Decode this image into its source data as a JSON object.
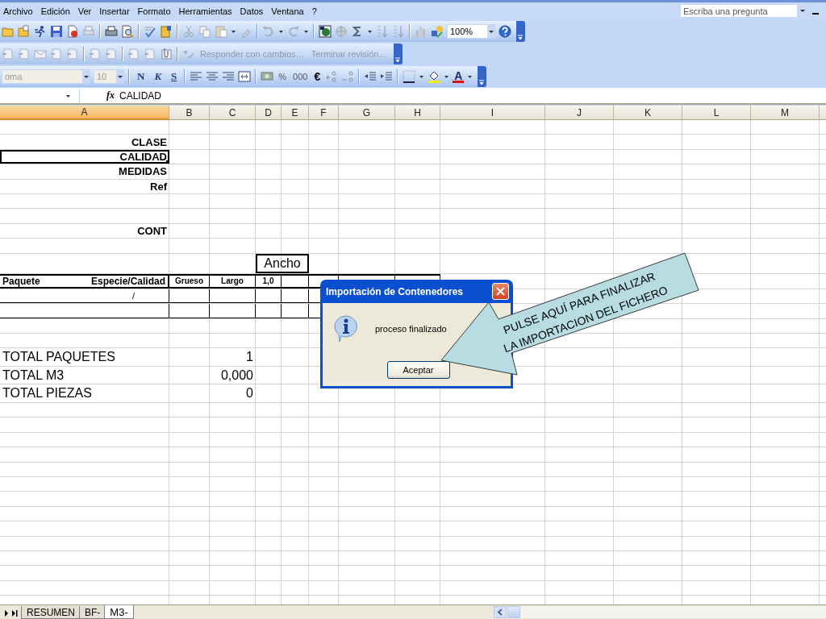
{
  "menu": {
    "items": [
      "Archivo",
      "Edición",
      "Ver",
      "Insertar",
      "Formato",
      "Herramientas",
      "Datos",
      "Ventana",
      "?"
    ],
    "help_box": {
      "placeholder": "Escriba una pregunta"
    }
  },
  "standard_toolbar": {
    "zoom": "100%"
  },
  "review_toolbar": {
    "buttons": [
      "Responder con cambios…",
      "Terminar revisión…"
    ]
  },
  "format_toolbar": {
    "font": "oma",
    "size": "10",
    "style_buttons": [
      "N",
      "K",
      "S"
    ],
    "number_buttons": [
      "%",
      "000",
      "€"
    ],
    "font_color_label": "A"
  },
  "formula_bar": {
    "function_label": "fx",
    "formula": "CALIDAD"
  },
  "sheet": {
    "columns": [
      {
        "label": "A",
        "selected": true
      },
      {
        "label": "B",
        "selected": false
      },
      {
        "label": "C",
        "selected": false
      },
      {
        "label": "D",
        "selected": false
      },
      {
        "label": "E",
        "selected": false
      },
      {
        "label": "F",
        "selected": false
      },
      {
        "label": "G",
        "selected": false
      },
      {
        "label": "H",
        "selected": false
      },
      {
        "label": "I",
        "selected": false
      },
      {
        "label": "J",
        "selected": false
      },
      {
        "label": "K",
        "selected": false
      },
      {
        "label": "L",
        "selected": false
      },
      {
        "label": "M",
        "selected": false
      }
    ],
    "rows": [
      {
        "kind": "blank",
        "selected": false
      },
      {
        "kind": "label",
        "selected": false,
        "cells": {
          "A": "CLASE"
        }
      },
      {
        "kind": "label",
        "selected": true,
        "cells": {
          "A": "CALIDAD"
        }
      },
      {
        "kind": "label",
        "selected": false,
        "cells": {
          "A": "MEDIDAS"
        }
      },
      {
        "kind": "label",
        "selected": false,
        "cells": {
          "A": "Ref"
        }
      },
      {
        "kind": "blank",
        "selected": false
      },
      {
        "kind": "blank",
        "selected": false
      },
      {
        "kind": "label",
        "selected": false,
        "cells": {
          "A": "CONT"
        }
      },
      {
        "kind": "blank",
        "selected": false
      },
      {
        "kind": "ancho",
        "selected": false,
        "cells": {
          "D": "Ancho"
        }
      },
      {
        "kind": "table_header",
        "selected": false,
        "cells": {
          "A": [
            "Paquete",
            "Especie/Calidad"
          ],
          "B": "Grueso",
          "C": "Largo",
          "D": "1,0"
        }
      },
      {
        "kind": "table_row",
        "selected": false,
        "cells": {
          "A": "/"
        }
      },
      {
        "kind": "table_row",
        "selected": false
      },
      {
        "kind": "blank",
        "selected": false
      },
      {
        "kind": "blank",
        "selected": false
      },
      {
        "kind": "total",
        "selected": false,
        "cells": {
          "A": "TOTAL PAQUETES",
          "C": "1"
        }
      },
      {
        "kind": "total",
        "selected": false,
        "cells": {
          "A": "TOTAL M3",
          "C": "0,000"
        }
      },
      {
        "kind": "total",
        "selected": false,
        "cells": {
          "A": "TOTAL PIEZAS",
          "C": "0"
        }
      }
    ]
  },
  "sheet_tabs": [
    {
      "label": "RESUMEN",
      "selected": false
    },
    {
      "label": "BF-",
      "selected": false
    },
    {
      "label": "M3-",
      "selected": true
    }
  ],
  "dialog": {
    "title": "Importación de Contenedores",
    "message": "proceso finalizado",
    "button": "Aceptar"
  },
  "callout": {
    "lines": [
      "PULSE AQUÍ PARA FINALIZAR",
      "LA IMPORTACION DEL FICHERO"
    ]
  }
}
